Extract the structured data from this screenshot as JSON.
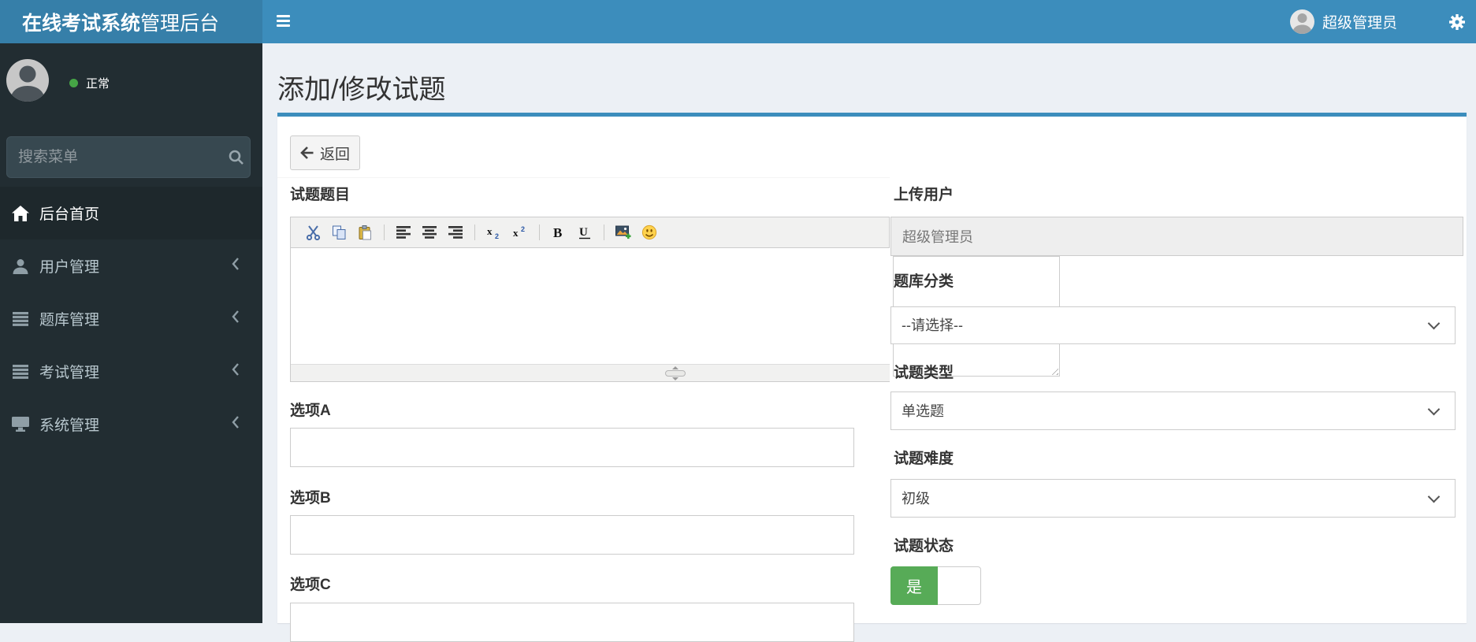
{
  "header": {
    "brand_bold": "在线考试系统",
    "brand_light": "管理后台",
    "user_name": "超级管理员"
  },
  "sidebar": {
    "status_label": "正常",
    "search_placeholder": "搜索菜单",
    "menu": [
      {
        "label": "后台首页",
        "icon": "home-icon",
        "active": true,
        "has_children": false
      },
      {
        "label": "用户管理",
        "icon": "user-icon",
        "active": false,
        "has_children": true
      },
      {
        "label": "题库管理",
        "icon": "list-icon",
        "active": false,
        "has_children": true
      },
      {
        "label": "考试管理",
        "icon": "list-icon",
        "active": false,
        "has_children": true
      },
      {
        "label": "系统管理",
        "icon": "desktop-icon",
        "active": false,
        "has_children": true
      }
    ]
  },
  "page": {
    "title": "添加/修改试题",
    "back_label": "返回"
  },
  "form": {
    "question_label": "试题题目",
    "editor_toolbar": [
      "cut",
      "copy",
      "paste",
      "align-left",
      "align-center",
      "align-right",
      "subscript",
      "superscript",
      "bold",
      "underline",
      "image",
      "emoticon"
    ],
    "upload_user": {
      "label": "上传用户",
      "value": "超级管理员"
    },
    "category": {
      "label": "题库分类",
      "selected": "--请选择--"
    },
    "qtype": {
      "label": "试题类型",
      "selected": "单选题"
    },
    "difficulty": {
      "label": "试题难度",
      "selected": "初级"
    },
    "status": {
      "label": "试题状态",
      "on_label": "是"
    },
    "options": [
      {
        "label": "选项A",
        "value": ""
      },
      {
        "label": "选项B",
        "value": ""
      },
      {
        "label": "选项C",
        "value": ""
      }
    ]
  },
  "colors": {
    "accent": "#3c8dbc",
    "logo-bg": "#367fa9",
    "sidebar-bg": "#222d32",
    "sidebar-active-bg": "#1e282c",
    "content-bg": "#ecf0f5",
    "toggle-on": "#57ab57",
    "status-dot": "#46a546"
  }
}
